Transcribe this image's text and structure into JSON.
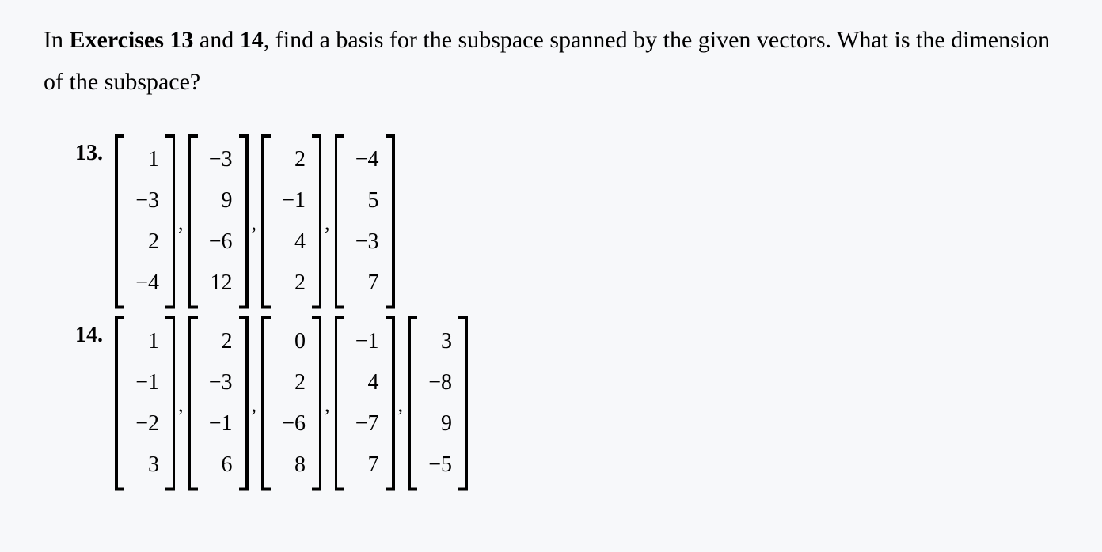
{
  "intro": {
    "prefix": "In ",
    "bold": "Exercises 13",
    "mid": " and ",
    "bold2": "14",
    "rest": ", find a basis for the subspace spanned by the given vectors. What is the dimension of the subspace?"
  },
  "problems": [
    {
      "num": "13.",
      "vectors": [
        [
          "1",
          "−3",
          "2",
          "−4"
        ],
        [
          "−3",
          "9",
          "−6",
          "12"
        ],
        [
          "2",
          "−1",
          "4",
          "2"
        ],
        [
          "−4",
          "5",
          "−3",
          "7"
        ]
      ]
    },
    {
      "num": "14.",
      "vectors": [
        [
          "1",
          "−1",
          "−2",
          "3"
        ],
        [
          "2",
          "−3",
          "−1",
          "6"
        ],
        [
          "0",
          "2",
          "−6",
          "8"
        ],
        [
          "−1",
          "4",
          "−7",
          "7"
        ],
        [
          "3",
          "−8",
          "9",
          "−5"
        ]
      ]
    }
  ],
  "comma": ","
}
